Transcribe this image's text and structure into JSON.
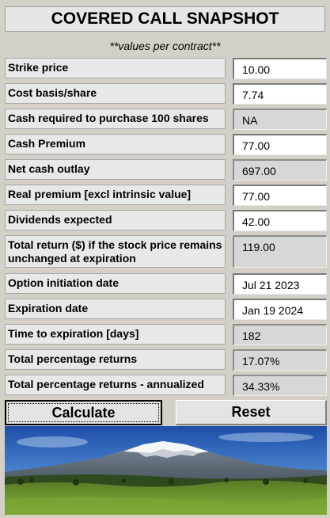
{
  "title": "COVERED CALL SNAPSHOT",
  "subtitle": "**values per contract**",
  "rows": [
    {
      "label": "Strike price",
      "value": "10.00"
    },
    {
      "label": "Cost basis/share",
      "value": "7.74"
    },
    {
      "label": "Cash required to purchase 100 shares",
      "value": "NA"
    },
    {
      "label": "Cash Premium",
      "value": "77.00"
    },
    {
      "label": "Net cash outlay",
      "value": "697.00"
    },
    {
      "label": "Real premium [excl intrinsic value]",
      "value": "77.00"
    },
    {
      "label": "Dividends expected",
      "value": "42.00"
    },
    {
      "label": "Total return ($) if the stock price remains unchanged at expiration",
      "value": "119.00"
    },
    {
      "label": "Option initiation date",
      "value": "Jul 21 2023"
    },
    {
      "label": "Expiration date",
      "value": "Jan 19 2024"
    },
    {
      "label": "Time to expiration [days]",
      "value": "182"
    },
    {
      "label": "Total percentage returns",
      "value": "17.07%"
    },
    {
      "label": "Total percentage returns - annualized",
      "value": "34.33%"
    }
  ],
  "buttons": {
    "calculate": "Calculate",
    "reset": "Reset"
  }
}
